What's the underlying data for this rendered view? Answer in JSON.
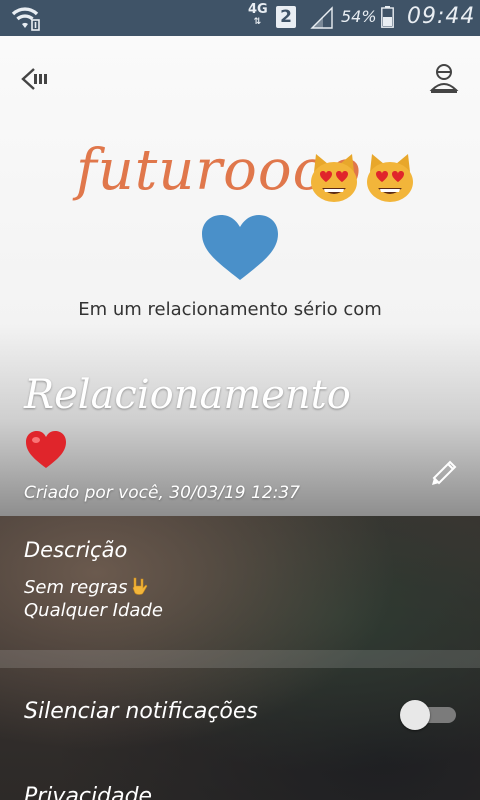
{
  "status_bar": {
    "network": "4G",
    "network_arrows": "⇅",
    "sim_slot": "2",
    "battery_percent": "54%",
    "time": "09:44",
    "icons": [
      "wifi-icon",
      "signal-icon",
      "battery-icon"
    ]
  },
  "header": {
    "back_icon": "back-arrow-icon",
    "profile_icon": "profile-icon"
  },
  "banner": {
    "title": "futuroooo",
    "emojis": [
      "heart-eyes-cat-icon",
      "heart-eyes-cat-icon",
      "blue-heart-icon"
    ],
    "subtitle": "Em um relacionamento sério com"
  },
  "chat": {
    "name": "Relacionamento",
    "name_emoji": "red-heart-icon",
    "created": "Criado por você, 30/03/19 12:37",
    "edit_icon": "pencil-icon"
  },
  "description": {
    "title": "Descrição",
    "line1": "Sem regras",
    "line1_emoji": "rock-on-hand-icon",
    "line2": "Qualquer Idade"
  },
  "settings": {
    "mute_label": "Silenciar notificações",
    "mute_enabled": false,
    "privacy_label": "Privacidade"
  },
  "colors": {
    "status_bar": "#3f5367",
    "banner_text": "#e0774b",
    "blue_heart": "#4a90c9",
    "red_heart": "#e0252b"
  }
}
